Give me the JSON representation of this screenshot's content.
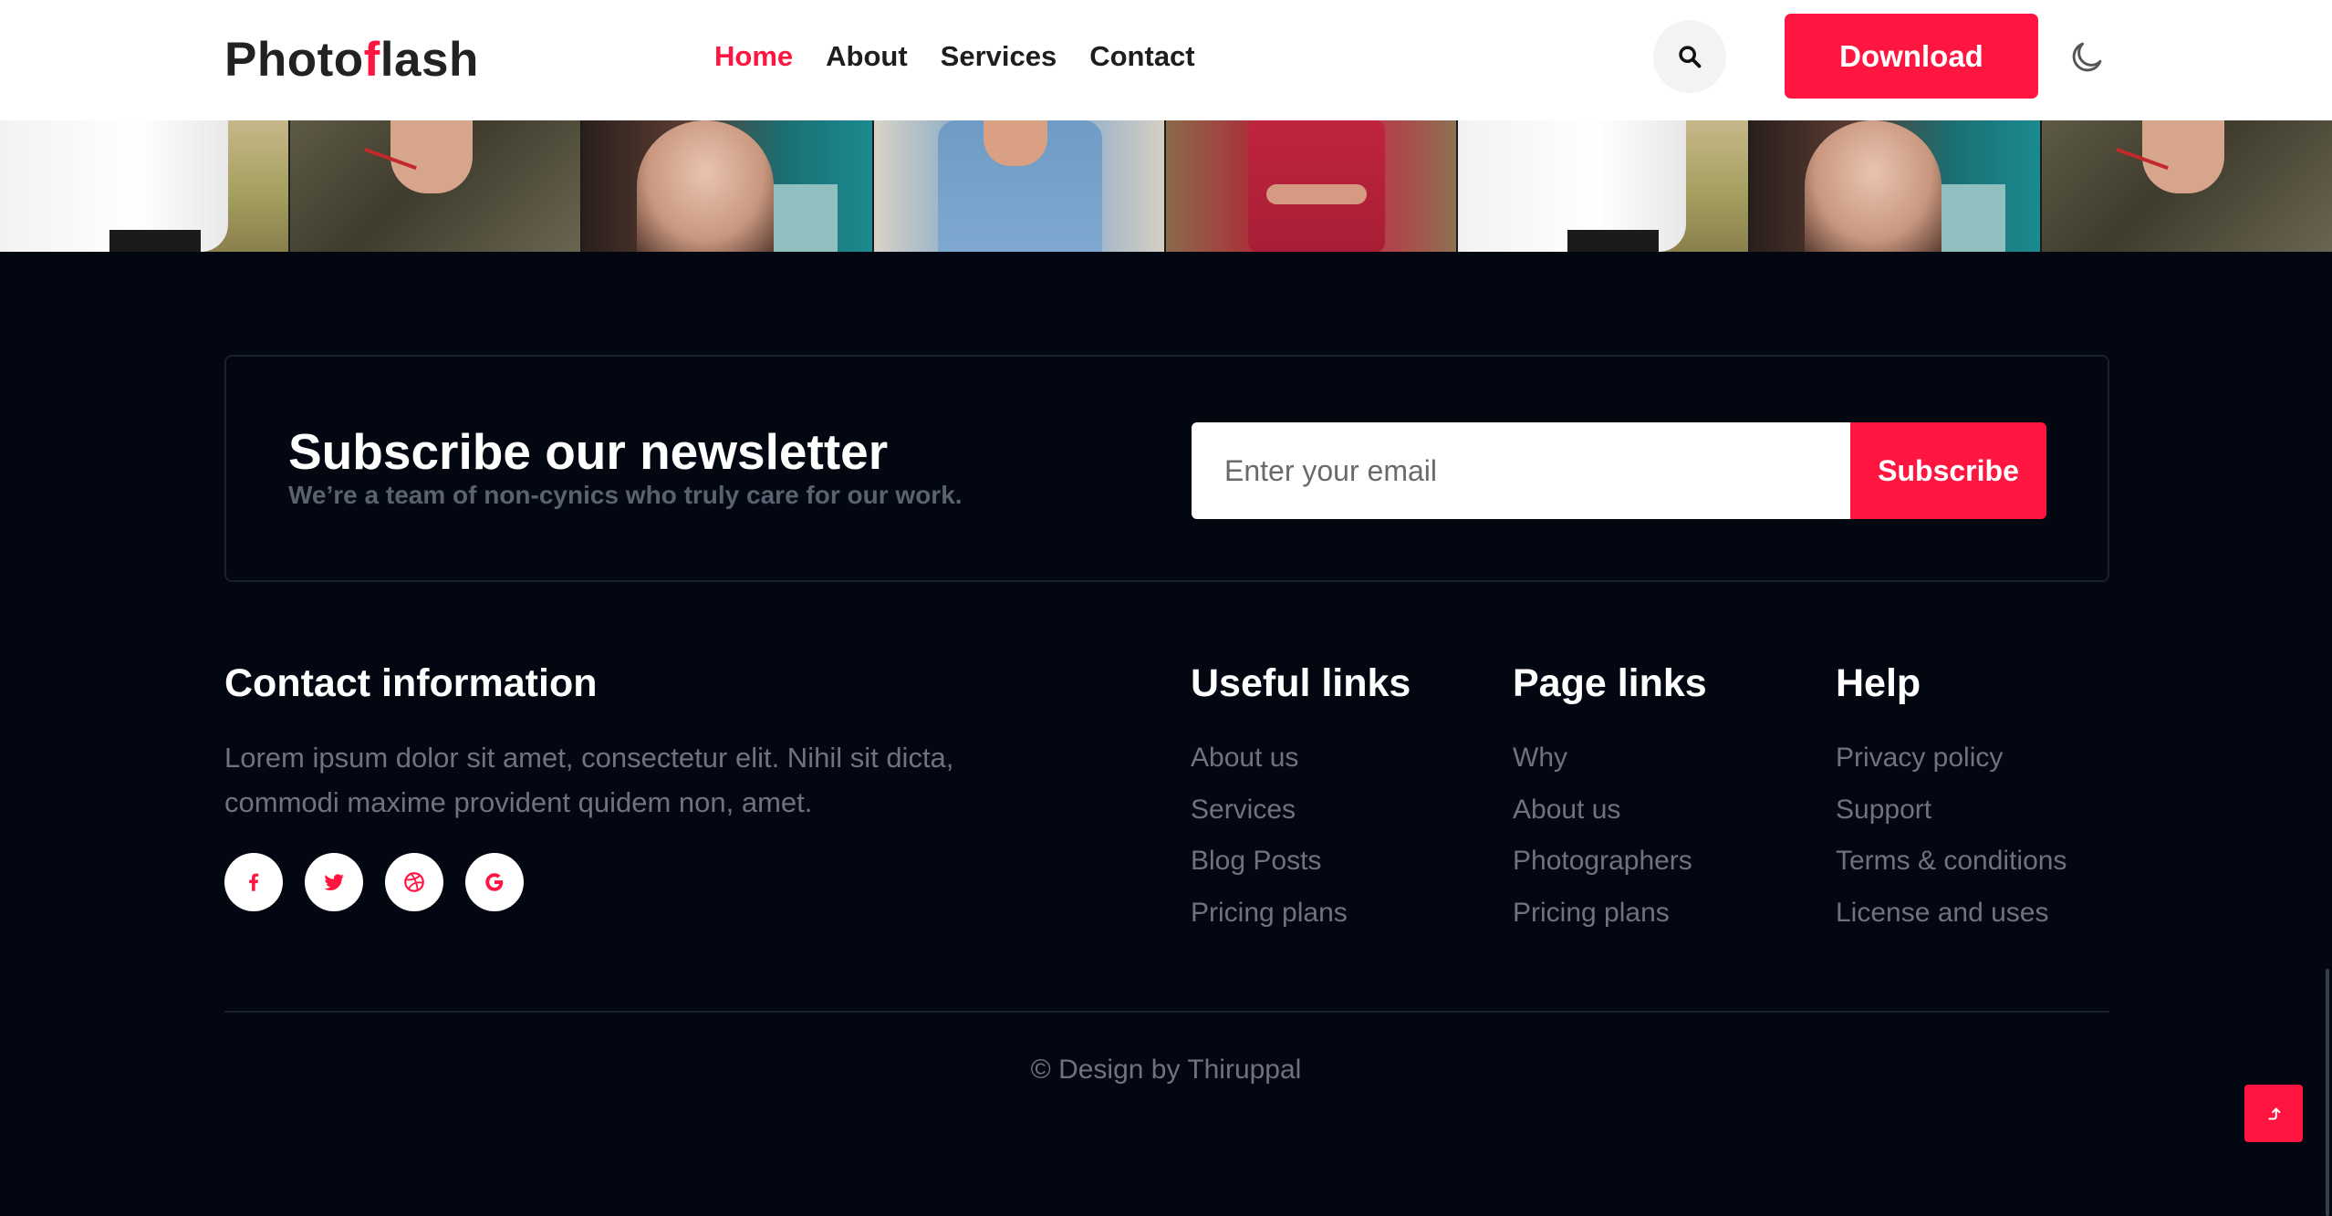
{
  "brand": {
    "part1": "Photo",
    "part2": "f",
    "part3": "lash"
  },
  "nav": {
    "links": [
      "Home",
      "About",
      "Services",
      "Contact"
    ],
    "active": "Home",
    "download_label": "Download"
  },
  "icons": {
    "search": "search-icon",
    "theme": "moon-icon",
    "facebook": "facebook-icon",
    "twitter": "twitter-icon",
    "dribbble": "dribbble-icon",
    "google": "google-icon",
    "back_to_top": "arrow-up-icon"
  },
  "colors": {
    "accent": "#ff1640",
    "background": "#030712",
    "muted": "#6f7380"
  },
  "newsletter": {
    "title": "Subscribe our newsletter",
    "subtitle": "We’re a team of non-cynics who truly care for our work.",
    "placeholder": "Enter your email",
    "button_label": "Subscribe"
  },
  "contact": {
    "heading": "Contact information",
    "text": "Lorem ipsum dolor sit amet, consectetur elit. Nihil sit dicta, commodi maxime provident quidem non, amet."
  },
  "useful_links": {
    "heading": "Useful links",
    "items": [
      "About us",
      "Services",
      "Blog Posts",
      "Pricing plans"
    ]
  },
  "page_links": {
    "heading": "Page links",
    "items": [
      "Why",
      "About us",
      "Photographers",
      "Pricing plans"
    ]
  },
  "help": {
    "heading": "Help",
    "items": [
      "Privacy policy",
      "Support",
      "Terms & conditions",
      "License and uses"
    ]
  },
  "footer": {
    "copyright": "© Design by Thiruppal"
  }
}
